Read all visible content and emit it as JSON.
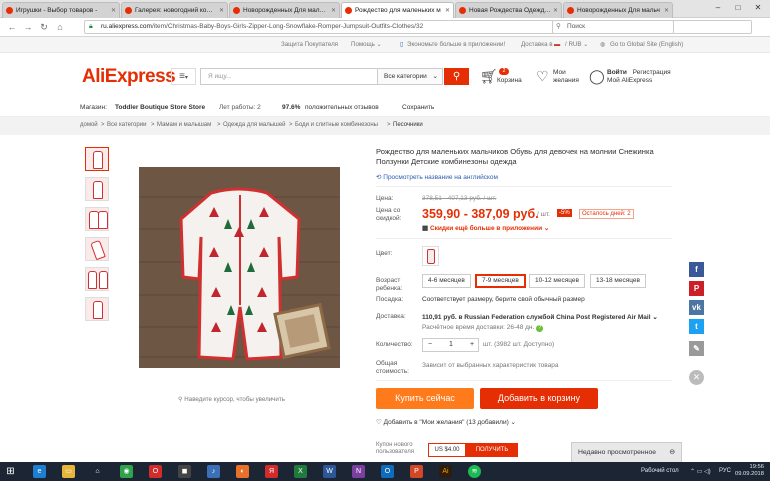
{
  "browser": {
    "tabs": [
      {
        "label": "Игрушки - Выбор товаров -",
        "icon": "aliexpress-tab-icon",
        "color": "#e62e04"
      },
      {
        "label": "Галерея: новогодний комплект",
        "icon": "aliexpress-tab-icon",
        "color": "#e62e04"
      },
      {
        "label": "Новорожденных Для мальчиков",
        "icon": "aliexpress-tab-icon",
        "color": "#e62e04"
      },
      {
        "label": "Рождество для маленьких м",
        "icon": "aliexpress-tab-icon",
        "color": "#e62e04"
      },
      {
        "label": "Новая Рождества Одежда д",
        "icon": "aliexpress-tab-icon",
        "color": "#e62e04"
      },
      {
        "label": "Новорожденных Для мальч",
        "icon": "aliexpress-tab-icon",
        "color": "#e62e04"
      }
    ],
    "url_host": "ru.aliexpress.com",
    "url_path": "/item/Christmas-Baby-Boys-Girls-Zipper-Long-Snowflake-Romper-Jumpsuit-Outfits-Clothes/32",
    "search_placeholder": "Поиск"
  },
  "topstrip": {
    "buyer_protection": "Защита Покупателя",
    "help": "Помощь ⌄",
    "app": "Экономьте больше в приложении!",
    "ship_to": "Доставка в",
    "currency": "/ RUB ⌄",
    "global": "Go to Global Site (English)"
  },
  "header": {
    "logo": "AliExpress",
    "search_placeholder": "Я ищу...",
    "category_select": "Все категории",
    "cart_count": "2",
    "cart_label": "Корзина",
    "wishlist_label_1": "Мои",
    "wishlist_label_2": "желания",
    "signin": "Войти",
    "register": "Регистрация",
    "my_account": "Мой AliExpress"
  },
  "store": {
    "label": "Магазин:",
    "name": "Toddler Boutique Store Store",
    "years": "Лет работы: 2",
    "rating_value": "97.6%",
    "rating_text": "положительных отзывов",
    "save": "Сохранить"
  },
  "breadcrumb": [
    "домой",
    "Все категории",
    "Мамам и малышам",
    "Одежда для малышей",
    "Боди и слитные комбинезоны",
    "Песочники"
  ],
  "product": {
    "title": "Рождество для маленьких мальчиков Обувь для девочек на молнии Снежинка Ползунки Детские комбинезоны одежда",
    "translate": "Просмотреть название на английском",
    "price_label": "Цена:",
    "old_price": "378,51 - 407,13 руб. / шт.",
    "sale_label": "Цена со скидкой:",
    "new_price": "359,90 - 387,09 руб.",
    "unit": "/ шт.",
    "discount": "-5%",
    "remaining": "Осталось дней: 2",
    "app_discount": "Скидки ещё больше в приложении ⌄",
    "color_label": "Цвет:",
    "age_label": "Возраст ребенка:",
    "sizes": [
      "4-6 месяцев",
      "7-9 месяцев",
      "10-12 месяцев",
      "13-18 месяцев"
    ],
    "fit_label": "Посадка:",
    "fit_value": "Соответствует размеру, берите свой обычный размер",
    "delivery_label": "Доставка:",
    "delivery_value": "110,91 руб. в Russian Federation службой China Post Registered Air Mail ⌄",
    "delivery_time": "Расчётное время доставки: 26-48 дн.",
    "qty_label": "Количество:",
    "qty_minus": "−",
    "qty_value": "1",
    "qty_plus": "+",
    "qty_stock": "шт. (3982 шт. Доступно)",
    "total_label": "Общая стоимость:",
    "total_value": "Зависит от выбранных характеристик товара",
    "buy_now": "Купить сейчас",
    "add_to_cart": "Добавить в корзину",
    "wishlist": "Добавить в \"Мои желания\" (13 добавили) ⌄",
    "new_user": "Купон нового пользователя",
    "coupon": "US $4.00",
    "get": "ПОЛУЧИТЬ"
  },
  "zoom_hint": "Наведите курсор, чтобы увеличить",
  "recent": "Недавно просмотренное",
  "taskbar": {
    "search_label": "Рабочий стол",
    "lang": "РУС",
    "time": "19:56",
    "date": "09.09.2018"
  },
  "colors": {
    "accent": "#e62e04",
    "buy": "#ff7a1a",
    "link": "#2a5db0"
  }
}
